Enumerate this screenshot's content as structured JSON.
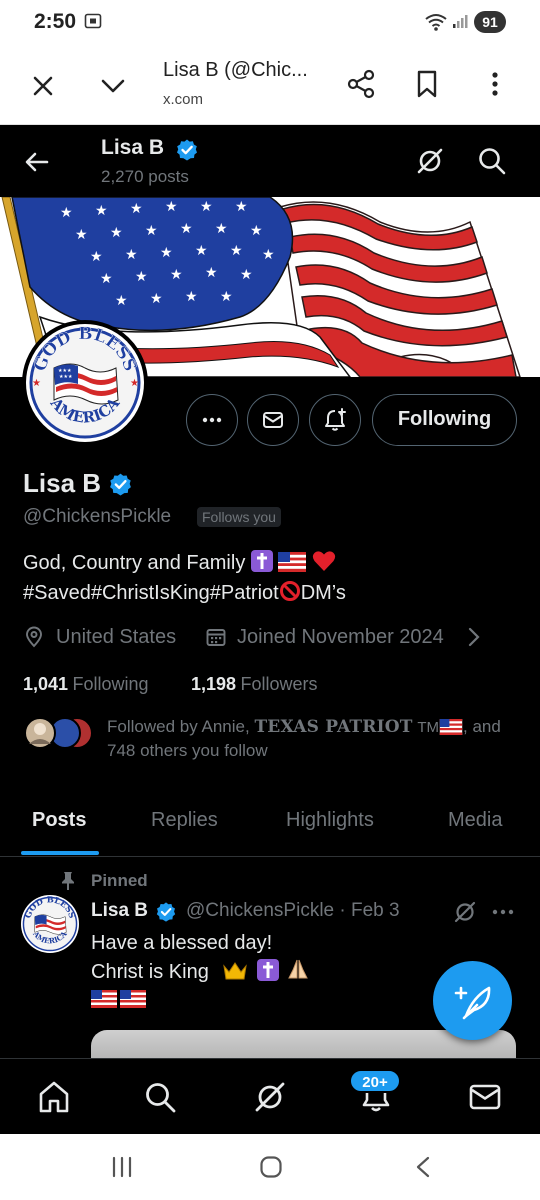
{
  "status_bar": {
    "time": "2:50",
    "battery": "91"
  },
  "browser": {
    "title": "Lisa B (@Chic...",
    "domain": "x.com"
  },
  "header": {
    "name": "Lisa B",
    "posts": "2,270 posts"
  },
  "profile": {
    "name": "Lisa B",
    "handle": "@ChickensPickle",
    "follows_you": "Follows you",
    "bio_line1": "God, Country and Family",
    "bio_line2a": "#Saved#ChristIsKing#Patriot",
    "bio_line2b": "DM’s",
    "location": "United States",
    "joined": "Joined November 2024",
    "following_count": "1,041",
    "following_label": "Following",
    "followers_count": "1,198",
    "followers_label": "Followers",
    "followed_by_prefix": "Followed by Annie,",
    "followed_by_name": "TEXAS PATRIOT",
    "followed_by_tm": "TM",
    "followed_by_suffix": ", and",
    "followed_by_others": "748 others you follow",
    "following_button": "Following"
  },
  "tabs": [
    "Posts",
    "Replies",
    "Highlights",
    "Media"
  ],
  "active_tab": "Posts",
  "pinned_post": {
    "pinned_label": "Pinned",
    "name": "Lisa B",
    "meta": "@ChickensPickle · Feb 3",
    "text": "Have  a blessed day!\nChrist is King"
  },
  "bottom_nav": {
    "notifications_badge": "20+"
  },
  "colors": {
    "accent": "#1d9bf0",
    "background": "#000000",
    "text": "#e7e9ea",
    "muted": "#71767b"
  },
  "banner_badge_text": "GOD BLESS AMERICA"
}
